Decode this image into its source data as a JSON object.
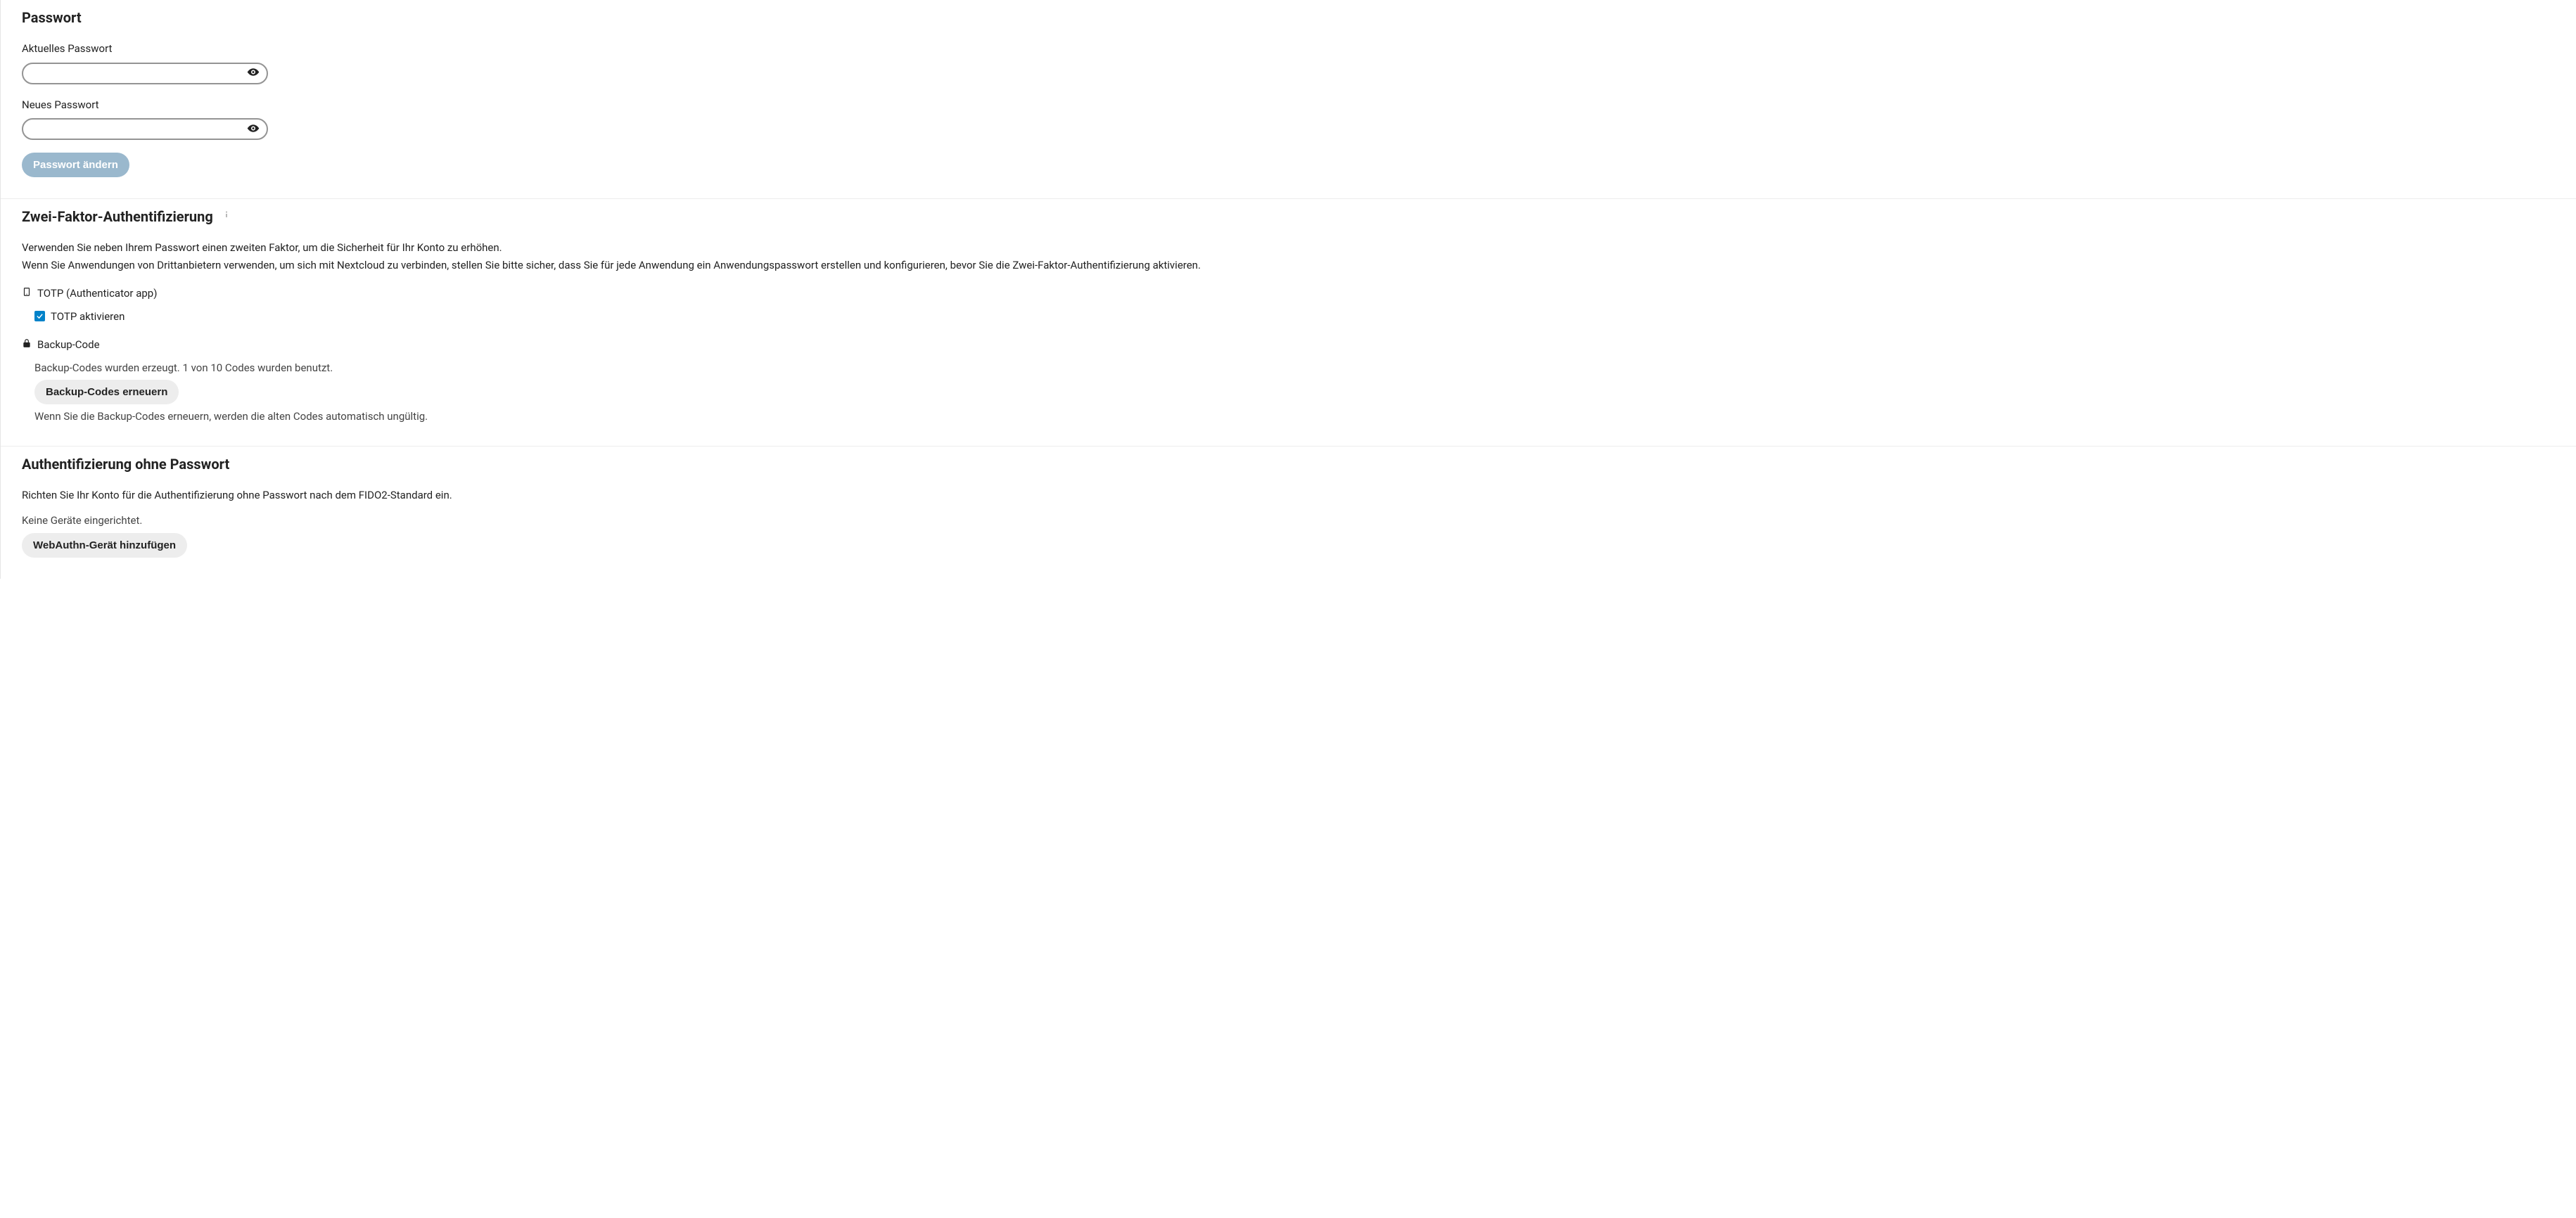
{
  "password_section": {
    "title": "Passwort",
    "current_label": "Aktuelles Passwort",
    "current_value": "",
    "new_label": "Neues Passwort",
    "new_value": "",
    "submit_label": "Passwort ändern"
  },
  "twofa_section": {
    "title": "Zwei-Faktor-Authentifizierung",
    "desc_line1": "Verwenden Sie neben Ihrem Passwort einen zweiten Faktor, um die Sicherheit für Ihr Konto zu erhöhen.",
    "desc_line2": "Wenn Sie Anwendungen von Drittanbietern verwenden, um sich mit Nextcloud zu verbinden, stellen Sie bitte sicher, dass Sie für jede Anwendung ein Anwendungspasswort erstellen und konfigurieren, bevor Sie die Zwei-Faktor-Authentifizierung aktivieren.",
    "totp": {
      "header": "TOTP (Authenticator app)",
      "enable_label": "TOTP aktivieren",
      "enabled": true
    },
    "backup": {
      "header": "Backup-Code",
      "status": "Backup-Codes wurden erzeugt. 1 von 10 Codes wurden benutzt.",
      "regen_label": "Backup-Codes erneuern",
      "regen_note": "Wenn Sie die Backup-Codes erneuern, werden die alten Codes automatisch ungültig."
    }
  },
  "passwordless_section": {
    "title": "Authentifizierung ohne Passwort",
    "desc": "Richten Sie Ihr Konto für die Authentifizierung ohne Passwort nach dem FIDO2-Standard ein.",
    "status": "Keine Geräte eingerichtet.",
    "add_label": "WebAuthn-Gerät hinzufügen"
  }
}
